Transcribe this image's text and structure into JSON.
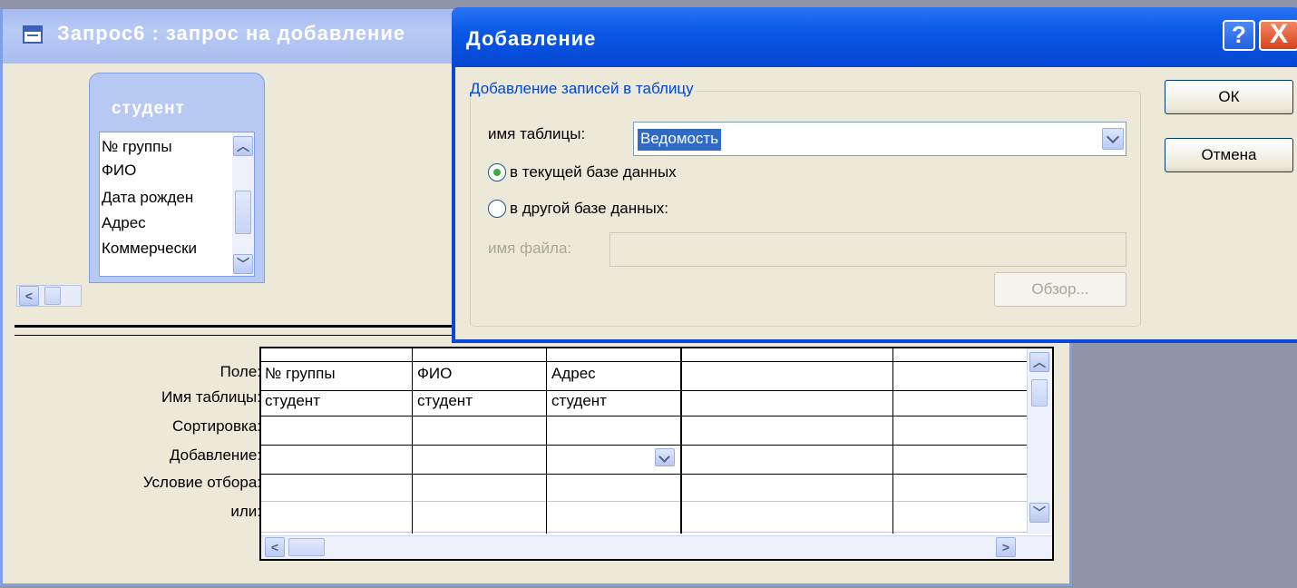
{
  "query_window": {
    "title": "Запрос6 : запрос на добавление",
    "table_box": {
      "title": "студент",
      "fields": [
        "№ группы",
        "ФИО",
        "Дата рожден",
        "Адрес",
        "Коммерчески"
      ]
    }
  },
  "grid": {
    "row_labels": [
      "Поле:",
      "Имя таблицы:",
      "Сортировка:",
      "Добавление:",
      "Условие отбора:",
      "или:"
    ],
    "columns": [
      {
        "field": "№ группы",
        "table": "студент"
      },
      {
        "field": "ФИО",
        "table": "студент"
      },
      {
        "field": "Адрес",
        "table": "студент"
      },
      {
        "field": "",
        "table": ""
      },
      {
        "field": "",
        "table": ""
      }
    ]
  },
  "dialog": {
    "title": "Добавление",
    "help_label": "?",
    "close_label": "X",
    "group_label": "Добавление записей в таблицу",
    "table_name_label": "имя таблицы:",
    "table_name_value": "Ведомость",
    "radio_current_db": "в текущей базе данных",
    "radio_other_db": "в другой базе данных:",
    "file_name_label": "имя файла:",
    "file_name_value": "",
    "browse_label": "Обзор...",
    "ok_label": "ОК",
    "cancel_label": "Отмена"
  }
}
